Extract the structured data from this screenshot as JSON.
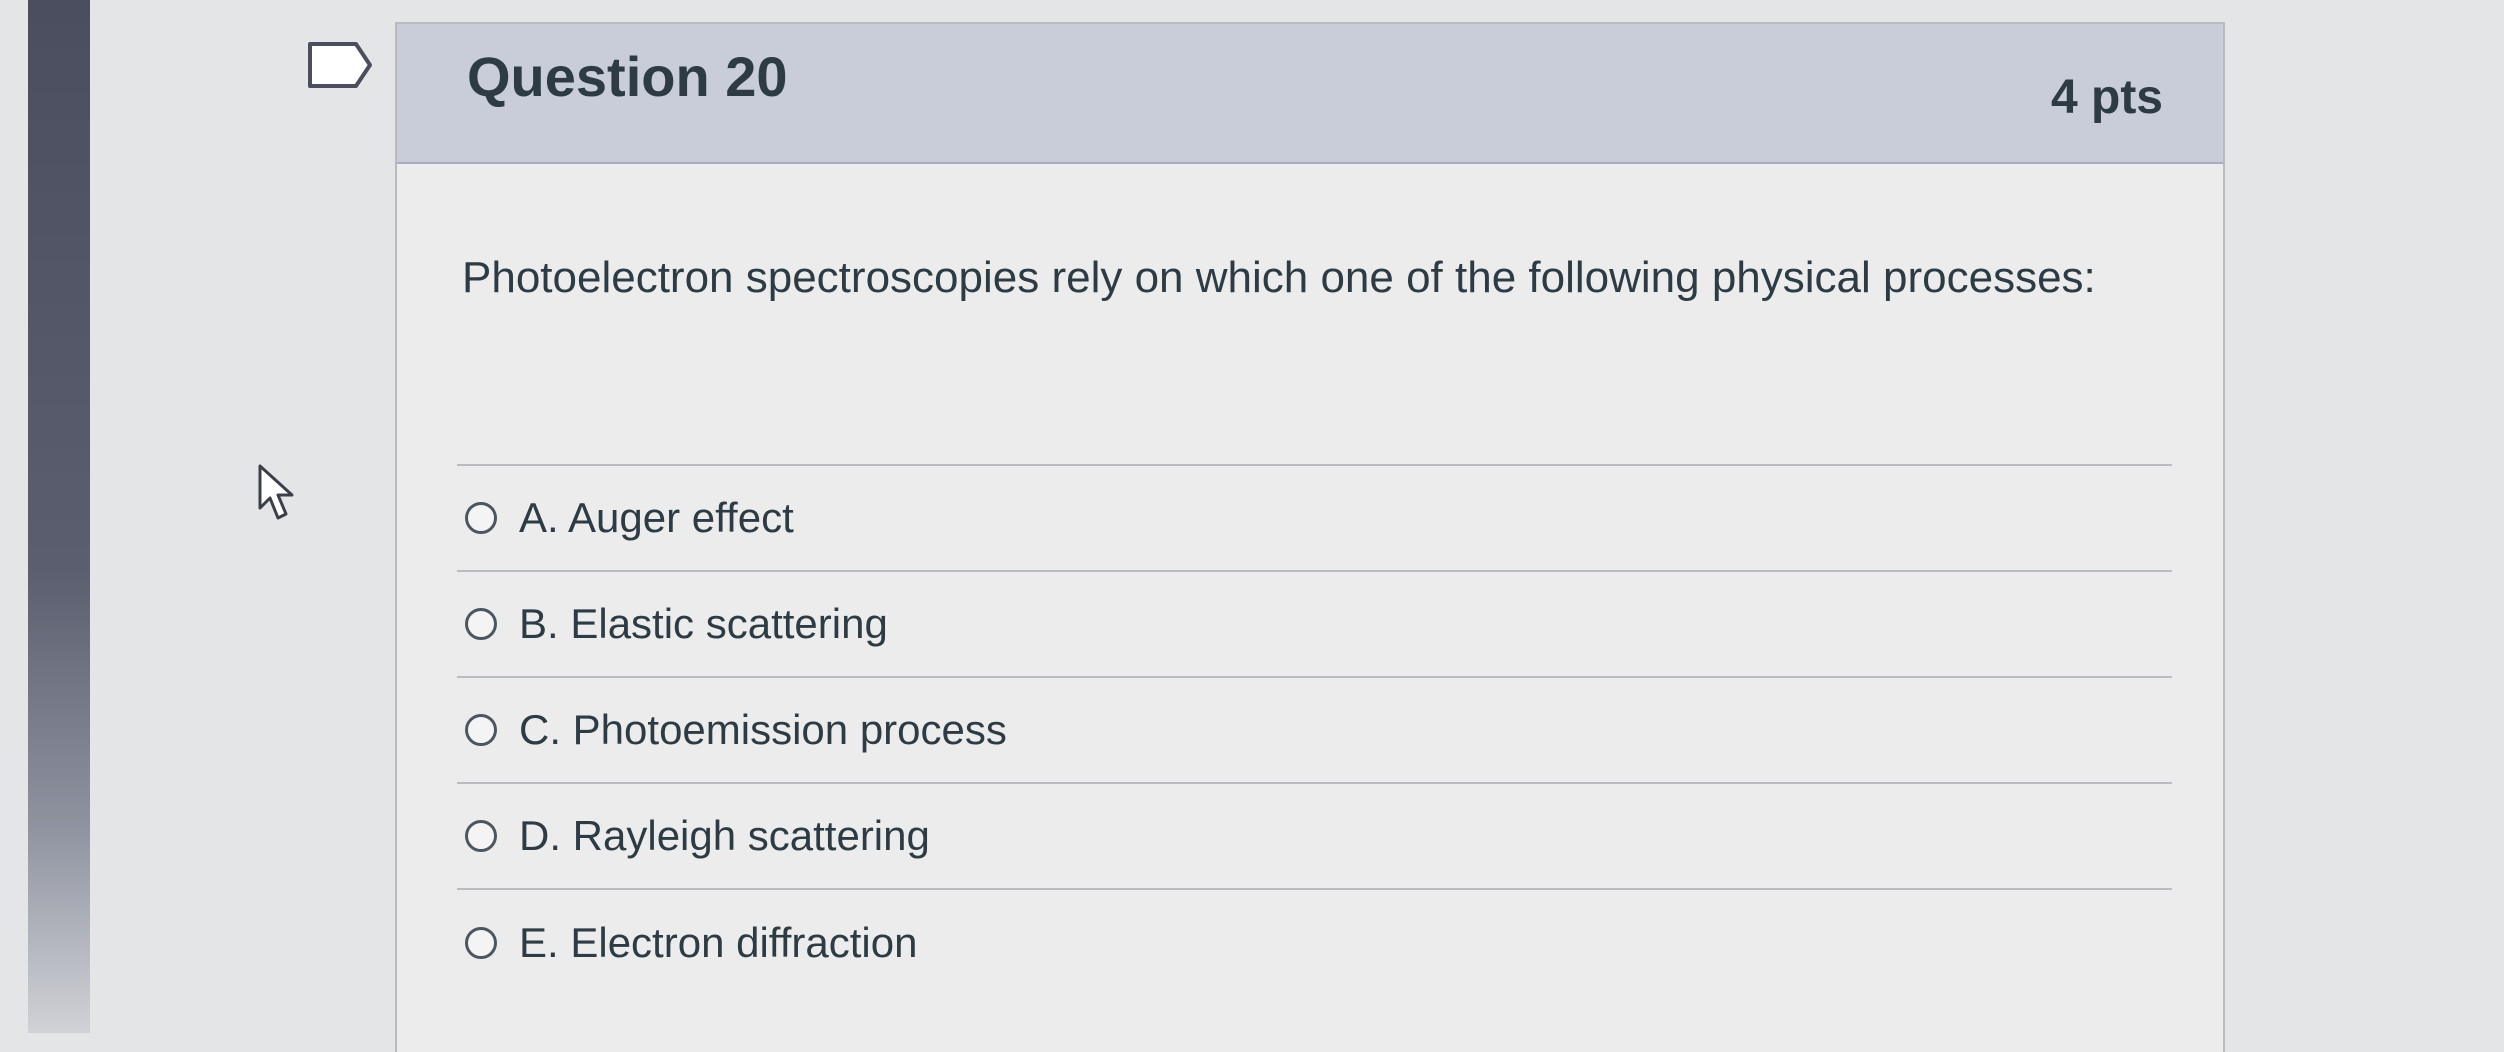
{
  "question": {
    "title": "Question 20",
    "points": "4 pts",
    "text": "Photoelectron spectroscopies rely on which one of the following physical processes:"
  },
  "answers": [
    {
      "label": "A. Auger effect",
      "selected": false
    },
    {
      "label": "B. Elastic scattering",
      "selected": false
    },
    {
      "label": "C. Photoemission process",
      "selected": false
    },
    {
      "label": "D. Rayleigh scattering",
      "selected": false
    },
    {
      "label": "E. Electron diffraction",
      "selected": false
    }
  ],
  "icons": {
    "flag": "flag-question-icon",
    "cursor": "mouse-pointer-icon"
  },
  "colors": {
    "header_bg": "#c9ccd9",
    "card_bg": "#ececec",
    "text": "#2d3b45",
    "sidebar": "#4a4e5e"
  }
}
